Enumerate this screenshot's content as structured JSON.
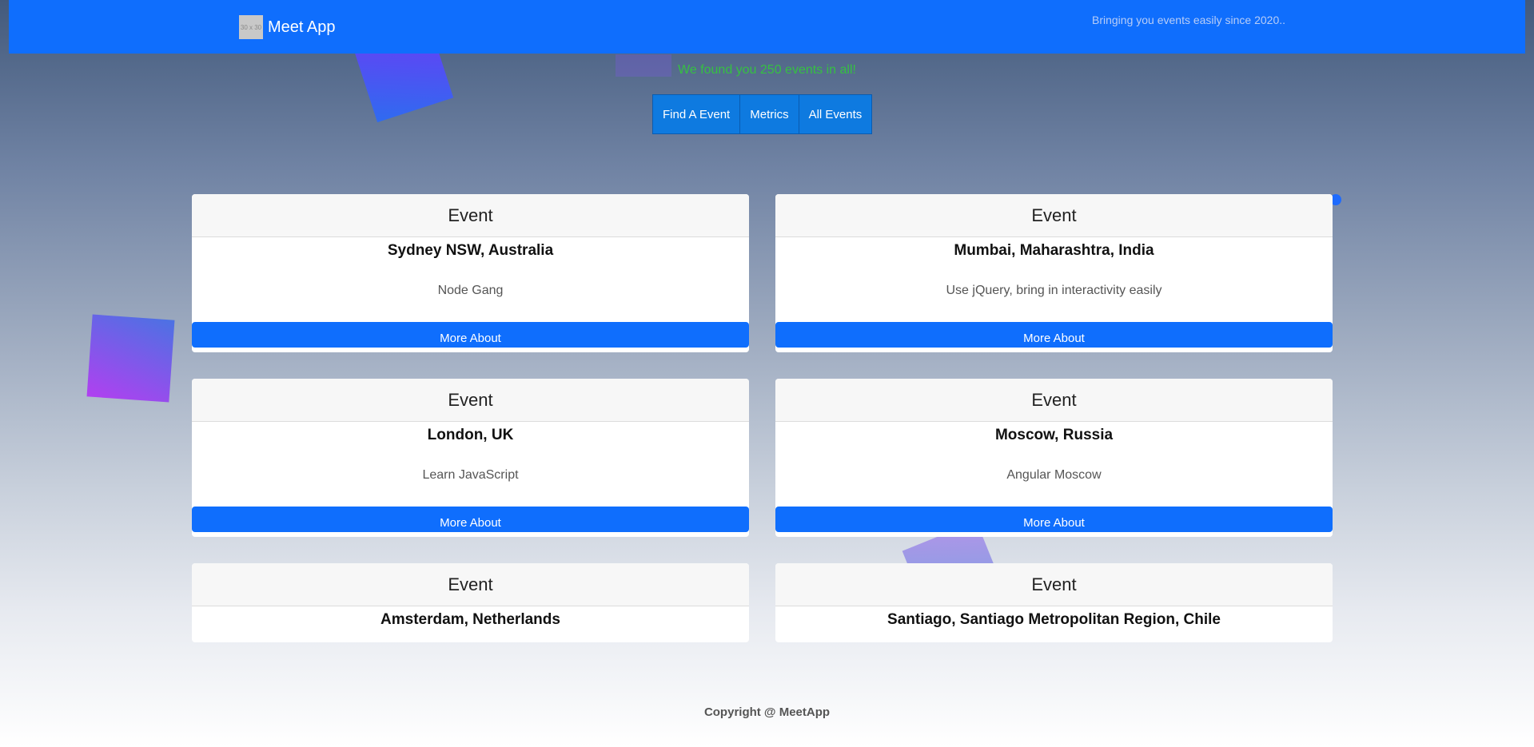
{
  "navbar": {
    "logo_placeholder": "30 x 30",
    "brand": "Meet App",
    "tagline": "Bringing you events easily since 2020.."
  },
  "summary": "We found you 250 events in all!",
  "nav_buttons": [
    "Find A Event",
    "Metrics",
    "All Events"
  ],
  "events": [
    {
      "header": "Event",
      "location": "Sydney NSW, Australia",
      "name": "Node Gang",
      "button": "More About"
    },
    {
      "header": "Event",
      "location": "Mumbai, Maharashtra, India",
      "name": "Use jQuery, bring in interactivity easily",
      "button": "More About"
    },
    {
      "header": "Event",
      "location": "London, UK",
      "name": "Learn JavaScript",
      "button": "More About"
    },
    {
      "header": "Event",
      "location": "Moscow, Russia",
      "name": "Angular Moscow",
      "button": "More About"
    },
    {
      "header": "Event",
      "location": "Amsterdam, Netherlands"
    },
    {
      "header": "Event",
      "location": "Santiago, Santiago Metropolitan Region, Chile"
    }
  ],
  "footer": "Copyright @ MeetApp"
}
